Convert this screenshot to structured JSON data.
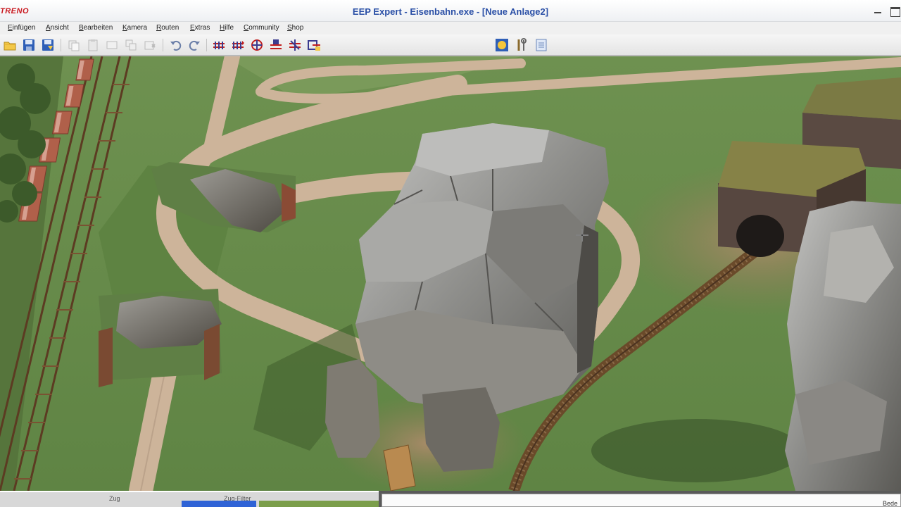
{
  "window": {
    "brand": "TRENO",
    "title": "EEP Expert - Eisenbahn.exe - [Neue Anlage2]"
  },
  "menu": [
    "Einfügen",
    "Ansicht",
    "Bearbeiten",
    "Kamera",
    "Routen",
    "Extras",
    "Hilfe",
    "Community",
    "Shop"
  ],
  "toolbar": {
    "combo_value": ""
  },
  "bottom": {
    "tab_a": "Zug",
    "tab_b": "Zug-Filter",
    "status": "Bede"
  },
  "colors": {
    "title_text": "#2a4fa6",
    "brand": "#c9181f",
    "grass": "#6f8e4e",
    "road": "#cdb49a",
    "rock": "#8a8a88"
  },
  "icons": [
    "open-icon",
    "save-icon",
    "save-as-icon",
    "copy-icon",
    "paste-icon",
    "cut-icon",
    "duplicate-icon",
    "delete-icon",
    "undo-icon",
    "redo-icon",
    "track-1-icon",
    "track-2-icon",
    "track-3-icon",
    "track-4-icon",
    "track-5-icon",
    "track-6-icon",
    "sun-icon",
    "tools-icon",
    "properties-icon"
  ]
}
